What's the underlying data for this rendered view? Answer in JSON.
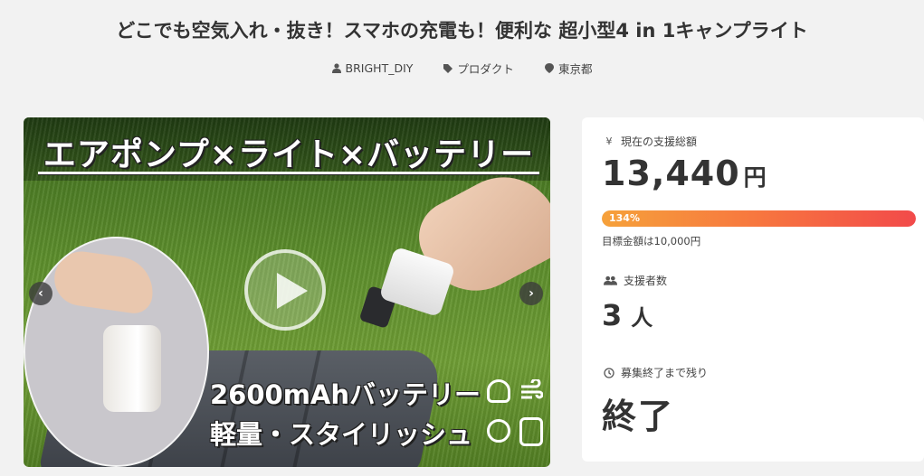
{
  "project": {
    "title": "どこでも空気入れ・抜き！スマホの充電も！便利な 超小型4 in 1キャンプライト",
    "owner": "BRIGHT_DIY",
    "category": "プロダクト",
    "location": "東京都"
  },
  "hero": {
    "headline": "エアポンプ×ライト×バッテリー",
    "caption_1": "2600mAhバッテリー",
    "caption_2": "軽量・スタイリッシュ",
    "prev_label": "‹",
    "next_label": "›"
  },
  "stats": {
    "raised_label": "現在の支援総額",
    "raised_amount": "13,440",
    "raised_unit": "円",
    "progress_percent": 134,
    "progress_text": "134%",
    "goal_text": "目標金額は10,000円",
    "backers_label": "支援者数",
    "backers_count": "3",
    "backers_unit": "人",
    "remaining_label": "募集終了まで残り",
    "remaining_value": "終了"
  },
  "icons": {
    "owner": "user-icon",
    "category": "tag-icon",
    "location": "map-pin-icon",
    "raised": "yen-icon",
    "backers": "users-icon",
    "remaining": "clock-icon"
  },
  "colors": {
    "progress_start": "#f6a13a",
    "progress_end": "#f24a4a",
    "background": "#f2f2f2"
  }
}
